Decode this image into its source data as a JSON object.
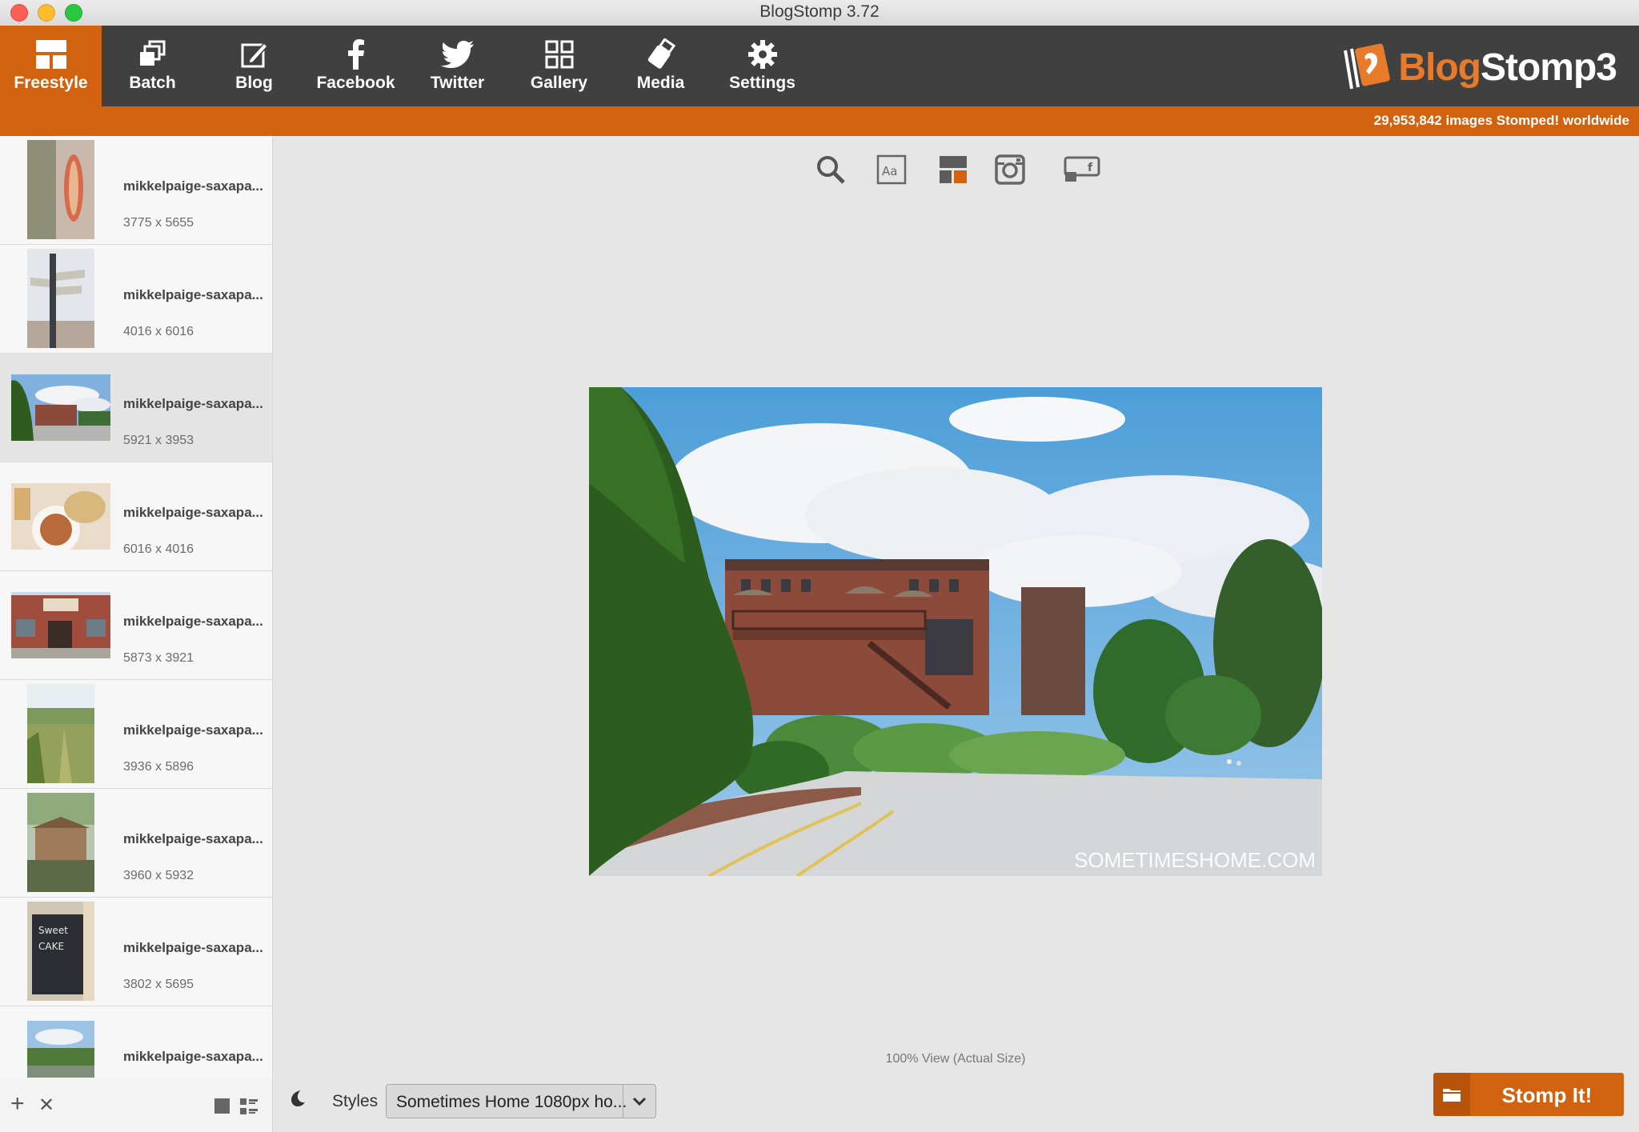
{
  "window": {
    "title": "BlogStomp 3.72"
  },
  "toolbar": {
    "tabs": [
      {
        "label": "Freestyle",
        "icon": "freestyle-layout-icon",
        "active": true
      },
      {
        "label": "Batch",
        "icon": "batch-stack-icon",
        "active": false
      },
      {
        "label": "Blog",
        "icon": "blog-edit-icon",
        "active": false
      },
      {
        "label": "Facebook",
        "icon": "facebook-icon",
        "active": false
      },
      {
        "label": "Twitter",
        "icon": "twitter-bird-icon",
        "active": false
      },
      {
        "label": "Gallery",
        "icon": "gallery-grid-icon",
        "active": false
      },
      {
        "label": "Media",
        "icon": "media-usb-icon",
        "active": false
      },
      {
        "label": "Settings",
        "icon": "settings-gear-icon",
        "active": false
      }
    ],
    "logo_text_1": "Blog",
    "logo_text_2": "Stomp3"
  },
  "banner": {
    "count_text": "29,953,842 images Stomped! worldwide"
  },
  "sidebar": {
    "items": [
      {
        "name": "mikkelpaige-saxapa...",
        "dims": "3775 x 5655",
        "orientation": "portrait",
        "active": false
      },
      {
        "name": "mikkelpaige-saxapa...",
        "dims": "4016 x 6016",
        "orientation": "portrait",
        "active": false
      },
      {
        "name": "mikkelpaige-saxapa...",
        "dims": "5921 x 3953",
        "orientation": "landscape",
        "active": true
      },
      {
        "name": "mikkelpaige-saxapa...",
        "dims": "6016 x 4016",
        "orientation": "landscape",
        "active": false
      },
      {
        "name": "mikkelpaige-saxapa...",
        "dims": "5873 x 3921",
        "orientation": "landscape",
        "active": false
      },
      {
        "name": "mikkelpaige-saxapa...",
        "dims": "3936 x 5896",
        "orientation": "portrait",
        "active": false
      },
      {
        "name": "mikkelpaige-saxapa...",
        "dims": "3960 x 5932",
        "orientation": "portrait",
        "active": false
      },
      {
        "name": "mikkelpaige-saxapa...",
        "dims": "3802 x 5695",
        "orientation": "portrait",
        "active": false
      },
      {
        "name": "mikkelpaige-saxapa...",
        "dims": "",
        "orientation": "landscape",
        "active": false
      }
    ],
    "add_glyph": "+",
    "remove_glyph": "✕"
  },
  "preview": {
    "tools": [
      "search-icon",
      "text-icon",
      "layout-icon",
      "instagram-icon",
      "facebook-cover-icon"
    ],
    "watermark": "SOMETIMESHOME.COM",
    "zoom_text": "100% View (Actual Size)"
  },
  "bottom": {
    "styles_label": "Styles",
    "styles_value": "Sometimes Home 1080px ho...",
    "stomp_label": "Stomp It!"
  },
  "colors": {
    "accent": "#d1620f",
    "toolbar": "#404040"
  }
}
